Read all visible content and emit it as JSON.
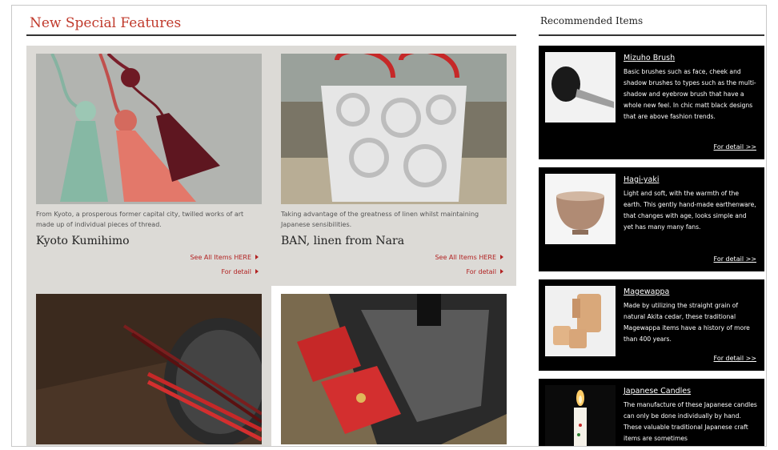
{
  "features": {
    "title": "New Special Features",
    "see_all_label": "See All Items HERE",
    "detail_label": "For detail",
    "cards": [
      {
        "desc": "From Kyoto, a prosperous former capital city, twilled works of art made up of individual pieces of thread.",
        "title": "Kyoto Kumihimo",
        "image": "kumihimo-tassels-photo"
      },
      {
        "desc": "Taking advantage of the greatness of linen whilst maintaining Japanese sensibilities.",
        "title": "BAN, linen from Nara",
        "image": "linen-tote-bag-photo"
      },
      {
        "image": "lacquered-chopsticks-photo"
      },
      {
        "image": "irori-hearth-cushions-photo"
      }
    ]
  },
  "recommended": {
    "title": "Recommended Items",
    "detail_label": "For detail >>",
    "items": [
      {
        "name": "Mizuho Brush",
        "desc": "Basic brushes such as face, cheek and shadow brushes to types such as the multi-shadow and eyebrow brush that have a whole new feel. In chic matt black designs that are above fashion trends.",
        "image": "makeup-brush-photo"
      },
      {
        "name": "Hagi-yaki",
        "desc": "Light and soft, with the warmth of the earth. This gently hand-made earthenware, that changes with age, looks simple and yet has many many fans.",
        "image": "ceramic-bowl-photo"
      },
      {
        "name": "Magewappa",
        "desc": "Made by utilizing the straight grain of natural Akita cedar, these traditional Magewappa items have a history of more than 400 years.",
        "image": "cedar-containers-photo"
      },
      {
        "name": "Japanese Candles",
        "desc": "The manufacture of these Japanese candles can only be done individually by hand. These valuable traditional Japanese craft items are sometimes",
        "image": "candle-photo"
      }
    ]
  }
}
